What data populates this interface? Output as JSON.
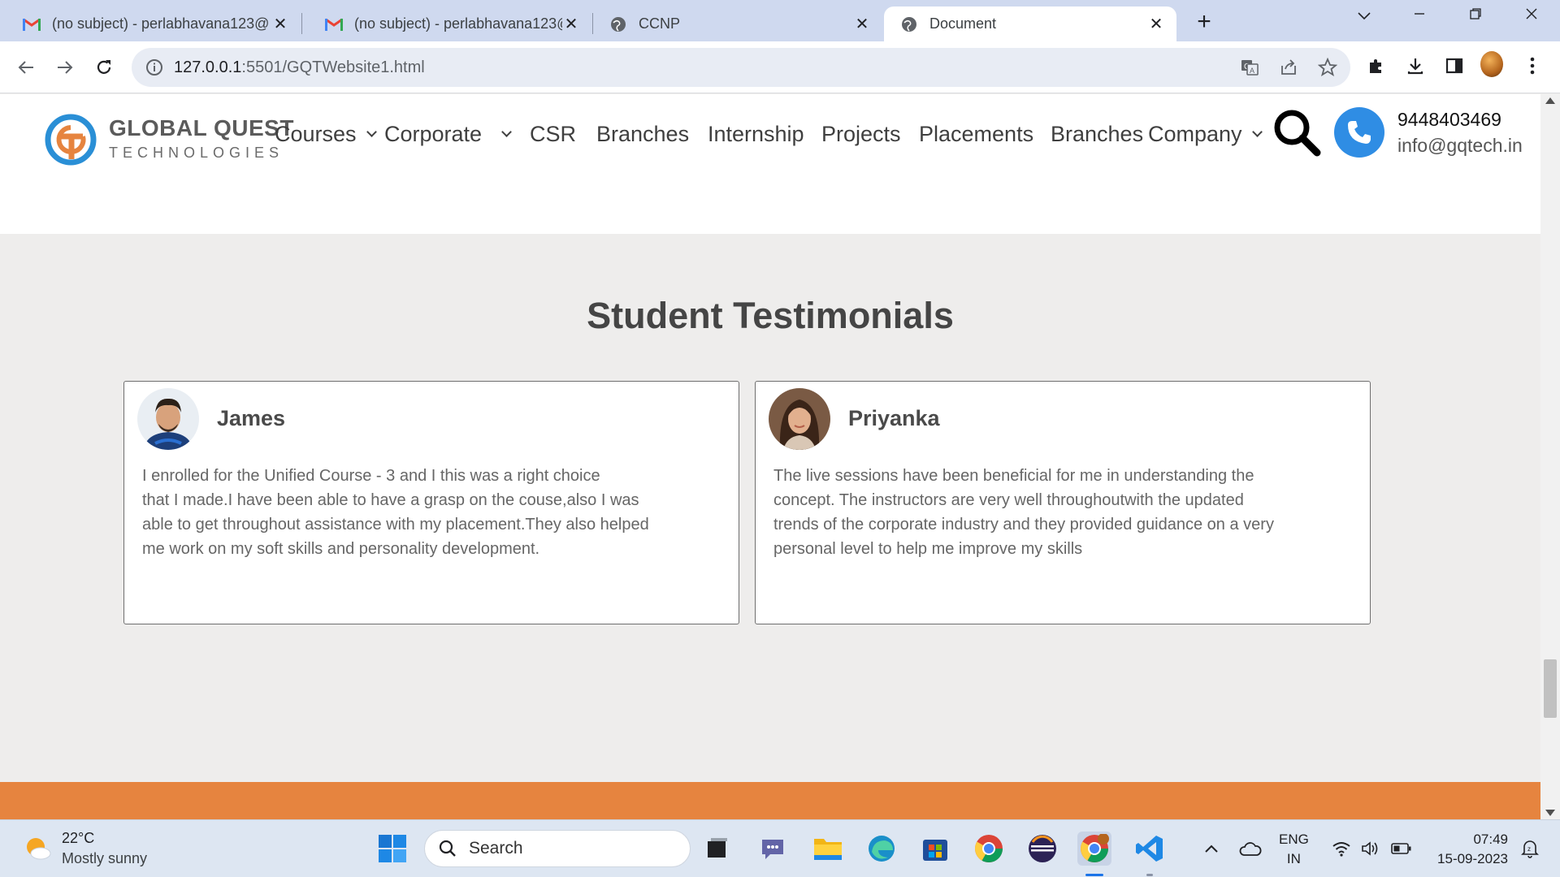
{
  "browser": {
    "tabs": [
      {
        "title": "(no subject) - perlabhavana123@",
        "icon": "gmail-icon"
      },
      {
        "title": "(no subject) - perlabhavana123@",
        "icon": "gmail-icon"
      },
      {
        "title": "CCNP",
        "icon": "globe-icon"
      },
      {
        "title": "Document",
        "icon": "globe-icon"
      }
    ],
    "address": {
      "host": "127.0.0.1",
      "rest": ":5501/GQTWebsite1.html"
    }
  },
  "site": {
    "logo": {
      "title": "GLOBAL QUEST",
      "subtitle": "TECHNOLOGIES"
    },
    "nav": [
      "Courses",
      "Corporate",
      "CSR",
      "Branches",
      "Internship",
      "Projects",
      "Placements",
      "Branches",
      "Company"
    ],
    "contact": {
      "phone": "9448403469",
      "email": "info@gqtech.in"
    },
    "section_title": "Student Testimonials",
    "testimonials": [
      {
        "name": "James",
        "lines": [
          "I enrolled for the Unified Course - 3 and I this was a right choice",
          "that I made.I have been able to have a grasp on the couse,also I was",
          "able to get throughout assistance with my placement.They also helped",
          "me work on my soft skills and personality development."
        ]
      },
      {
        "name": "Priyanka",
        "lines": [
          "The live sessions have been beneficial for me in understanding the",
          "concept. The instructors are very well throughoutwith the updated",
          "trends of the corporate industry and they provided guidance on a very",
          "personal level to help me improve my skills"
        ]
      }
    ]
  },
  "taskbar": {
    "weather": {
      "temp": "22°C",
      "condition": "Mostly sunny"
    },
    "search_label": "Search",
    "lang": {
      "line1": "ENG",
      "line2": "IN"
    },
    "clock": {
      "time": "07:49",
      "date": "15-09-2023"
    }
  },
  "colors": {
    "accent_orange": "#e6843f",
    "phone_blue": "#2f8de4",
    "logo_blue": "#2a8fd6"
  }
}
